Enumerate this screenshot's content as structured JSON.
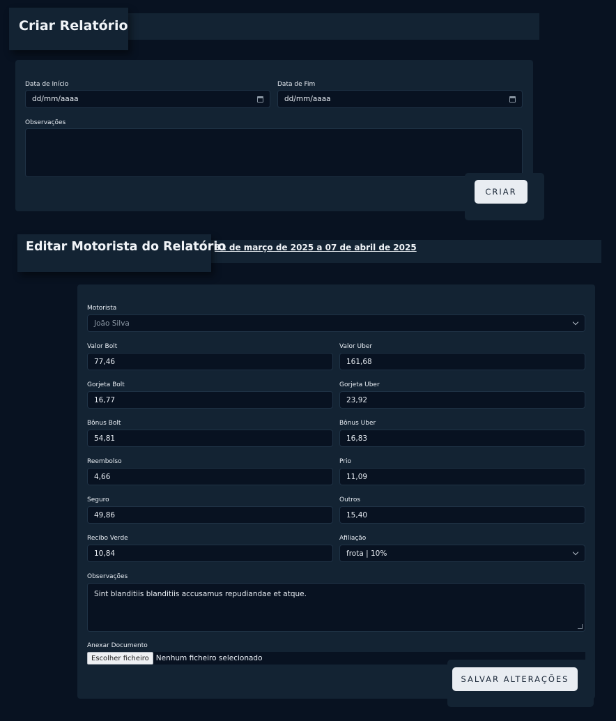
{
  "create": {
    "title": "Criar Relatório",
    "start_label": "Data de Início",
    "start_placeholder": "dd/mm/aaaa",
    "end_label": "Data de Fim",
    "end_placeholder": "dd/mm/aaaa",
    "notes_label": "Observações",
    "notes_value": "",
    "submit_label": "CRIAR"
  },
  "edit": {
    "title": "Editar Motorista do Relatório",
    "period": "31 de março de 2025 a 07 de abril de 2025",
    "driver_label": "Motorista",
    "driver_value": "João Silva",
    "fields": {
      "valor_bolt": {
        "label": "Valor Bolt",
        "value": "77,46"
      },
      "valor_uber": {
        "label": "Valor Uber",
        "value": "161,68"
      },
      "gorjeta_bolt": {
        "label": "Gorjeta Bolt",
        "value": "16,77"
      },
      "gorjeta_uber": {
        "label": "Gorjeta Uber",
        "value": "23,92"
      },
      "bonus_bolt": {
        "label": "Bônus Bolt",
        "value": "54,81"
      },
      "bonus_uber": {
        "label": "Bônus Uber",
        "value": "16,83"
      },
      "reembolso": {
        "label": "Reembolso",
        "value": "4,66"
      },
      "prio": {
        "label": "Prio",
        "value": "11,09"
      },
      "seguro": {
        "label": "Seguro",
        "value": "49,86"
      },
      "outros": {
        "label": "Outros",
        "value": "15,40"
      },
      "recibo_verde": {
        "label": "Recibo Verde",
        "value": "10,84"
      }
    },
    "affiliation_label": "Afiliação",
    "affiliation_value": "frota | 10%",
    "notes_label": "Observações",
    "notes_value": "Sint blanditiis blanditiis accusamus repudiandae et atque.",
    "attach_label": "Anexar Documento",
    "file_button": "Escolher ficheiro",
    "file_status": "Nenhum ficheiro selecionado",
    "save_label": "SALVAR ALTERAÇÕES"
  },
  "colors": {
    "background": "#081221",
    "panel": "#132333",
    "input": "#081221",
    "button": "#e9edf2"
  }
}
